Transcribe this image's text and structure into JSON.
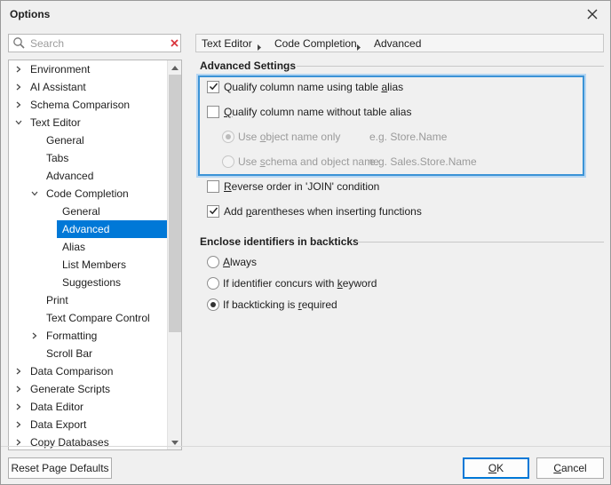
{
  "window": {
    "title": "Options"
  },
  "search": {
    "placeholder": "Search",
    "value": ""
  },
  "tree": {
    "items": [
      {
        "label": "Environment"
      },
      {
        "label": "AI Assistant"
      },
      {
        "label": "Schema Comparison"
      },
      {
        "label": "Text Editor"
      },
      {
        "label": "General"
      },
      {
        "label": "Tabs"
      },
      {
        "label": "Advanced"
      },
      {
        "label": "Code Completion"
      },
      {
        "label": "General"
      },
      {
        "label": "Advanced"
      },
      {
        "label": "Alias"
      },
      {
        "label": "List Members"
      },
      {
        "label": "Suggestions"
      },
      {
        "label": "Print"
      },
      {
        "label": "Text Compare Control"
      },
      {
        "label": "Formatting"
      },
      {
        "label": "Scroll Bar"
      },
      {
        "label": "Data Comparison"
      },
      {
        "label": "Generate Scripts"
      },
      {
        "label": "Data Editor"
      },
      {
        "label": "Data Export"
      },
      {
        "label": "Copy Databases"
      }
    ]
  },
  "breadcrumb": {
    "items": [
      "Text Editor",
      "Code Completion",
      "Advanced"
    ]
  },
  "advanced": {
    "title": "Advanced Settings",
    "qualify_with_alias": {
      "pre": "Qualify column name using table ",
      "key": "a",
      "post": "lias"
    },
    "qualify_without_alias": {
      "pre": "",
      "key": "Q",
      "post": "ualify column name without table alias"
    },
    "object_name_only": {
      "pre": "Use ",
      "key": "o",
      "post": "bject name only",
      "hint": "e.g. Store.Name"
    },
    "schema_and_object": {
      "pre": "Use ",
      "key": "s",
      "post": "chema and object name",
      "hint": "e.g. Sales.Store.Name"
    },
    "reverse_join": {
      "pre": "",
      "key": "R",
      "post": "everse order in 'JOIN' condition"
    },
    "add_parentheses": {
      "pre": "Add ",
      "key": "p",
      "post": "arentheses when inserting functions"
    }
  },
  "backticks": {
    "title": "Enclose identifiers in backticks",
    "always": {
      "pre": "",
      "key": "A",
      "post": "lways"
    },
    "concurs_keyword": {
      "pre": "If identifier concurs with ",
      "key": "k",
      "post": "eyword"
    },
    "required": {
      "pre": "If backticking is ",
      "key": "r",
      "post": "equired"
    }
  },
  "buttons": {
    "reset": "Reset Page Defaults",
    "ok": {
      "key": "O",
      "post": "K"
    },
    "cancel": {
      "key": "C",
      "post": "ancel"
    }
  },
  "colors": {
    "selection": "#0078d7",
    "focus_border": "#3b93d6"
  }
}
